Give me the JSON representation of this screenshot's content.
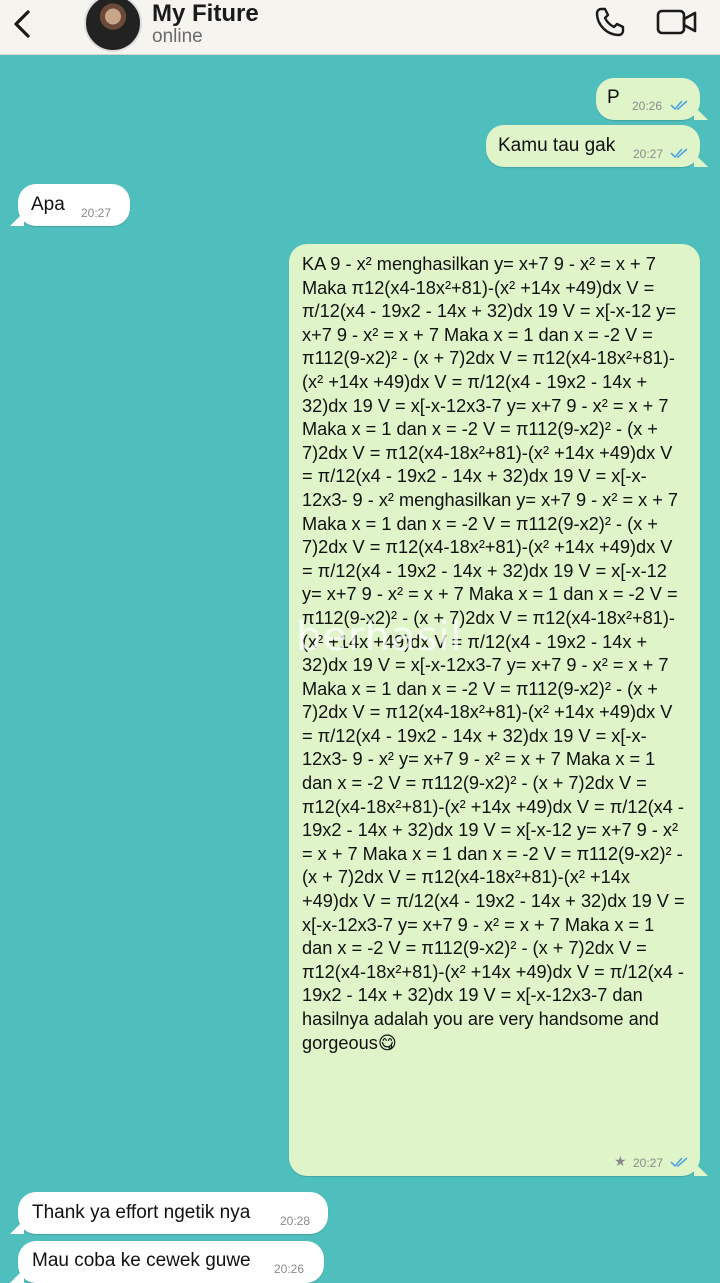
{
  "header": {
    "contact_name": "My Fiture",
    "status": "online"
  },
  "messages": [
    {
      "text": "P",
      "time": "20:26",
      "direction": "out"
    },
    {
      "text": "Kamu tau gak",
      "time": "20:27",
      "direction": "out"
    },
    {
      "text": "Apa",
      "time": "20:27",
      "direction": "in"
    },
    {
      "text": "KA 9 - x² menghasilkan y= x+7 9 - x² = x + 7 Maka π12(x4-18x²+81)-(x² +14x +49)dx V = π/12(x4 - 19x2 - 14x + 32)dx 19 V = x[-x-12 y= x+7 9 - x² = x + 7 Maka x = 1 dan x = -2 V = π112(9-x2)² - (x + 7)2dx V = π12(x4-18x²+81)-(x² +14x +49)dx V = π/12(x4 - 19x2 - 14x + 32)dx 19 V = x[-x-12x3-7 y= x+7 9 - x² = x + 7 Maka x = 1 dan x = -2 V = π112(9-x2)² - (x + 7)2dx V = π12(x4-18x²+81)-(x² +14x +49)dx V = π/12(x4 - 19x2 - 14x + 32)dx 19 V = x[-x-12x3- 9 - x² menghasilkan y= x+7 9 - x² = x + 7 Maka x = 1 dan x = -2 V = π112(9-x2)² - (x + 7)2dx V = π12(x4-18x²+81)-(x² +14x +49)dx V = π/12(x4 - 19x2 - 14x + 32)dx 19 V = x[-x-12 y= x+7 9 - x² = x + 7 Maka x = 1 dan x = -2 V = π112(9-x2)² - (x + 7)2dx V = π12(x4-18x²+81)-(x² +14x +49)dx V = π/12(x4 - 19x2 - 14x + 32)dx 19 V = x[-x-12x3-7 y= x+7 9 - x² = x + 7 Maka x = 1 dan x = -2 V = π112(9-x2)² - (x + 7)2dx V = π12(x4-18x²+81)-(x² +14x +49)dx V = π/12(x4 - 19x2 - 14x + 32)dx 19 V = x[-x-12x3- 9 - x² y= x+7 9 - x² = x + 7 Maka x = 1 dan x = -2 V = π112(9-x2)² - (x + 7)2dx V = π12(x4-18x²+81)-(x² +14x +49)dx V = π/12(x4 - 19x2 - 14x + 32)dx 19 V = x[-x-12 y= x+7 9 - x² = x + 7 Maka x = 1 dan x = -2 V = π112(9-x2)² - (x + 7)2dx V = π12(x4-18x²+81)-(x² +14x +49)dx V = π/12(x4 - 19x2 - 14x + 32)dx 19 V = x[-x-12x3-7 y= x+7 9 - x² = x + 7 Maka x = 1 dan x = -2 V = π112(9-x2)² - (x + 7)2dx V = π12(x4-18x²+81)-(x² +14x +49)dx V = π/12(x4 - 19x2 - 14x + 32)dx 19 V = x[-x-12x3-7 dan hasilnya adalah you are very handsome and gorgeous😋",
      "time": "20:27",
      "direction": "out",
      "starred": true
    },
    {
      "text": "Thank ya effort ngetik nya",
      "time": "20:28",
      "direction": "in"
    },
    {
      "text": "Mau coba ke cewek guwe",
      "time": "20:26",
      "direction": "in"
    }
  ],
  "watermark": "berhasil",
  "colors": {
    "chat_background": "#4fbfbe",
    "outgoing_bubble": "#dff5c9",
    "incoming_bubble": "#ffffff",
    "read_ticks": "#4fa3e0"
  }
}
